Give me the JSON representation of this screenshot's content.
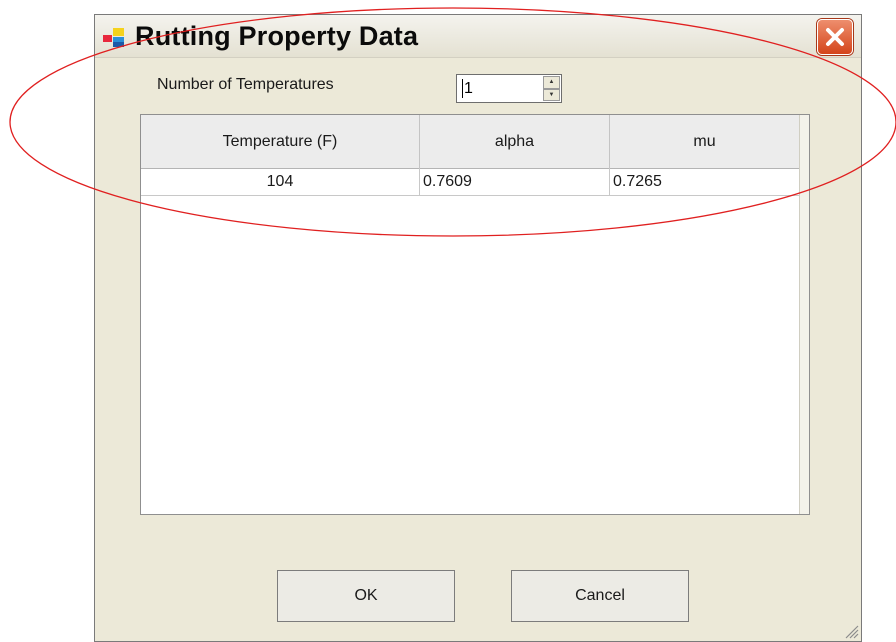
{
  "window": {
    "title": "Rutting Property Data",
    "app_icon": "colored-squares-icon",
    "close_icon": "close-x-icon"
  },
  "temperature_count": {
    "label": "Number of Temperatures",
    "value": "1"
  },
  "table": {
    "columns": [
      "Temperature (F)",
      "alpha",
      "mu"
    ],
    "rows": [
      [
        "104",
        "0.7609",
        "0.7265"
      ]
    ]
  },
  "buttons": {
    "ok": "OK",
    "cancel": "Cancel"
  },
  "colors": {
    "annotation_ellipse": "#e02020",
    "close_button": "#d4451b"
  }
}
